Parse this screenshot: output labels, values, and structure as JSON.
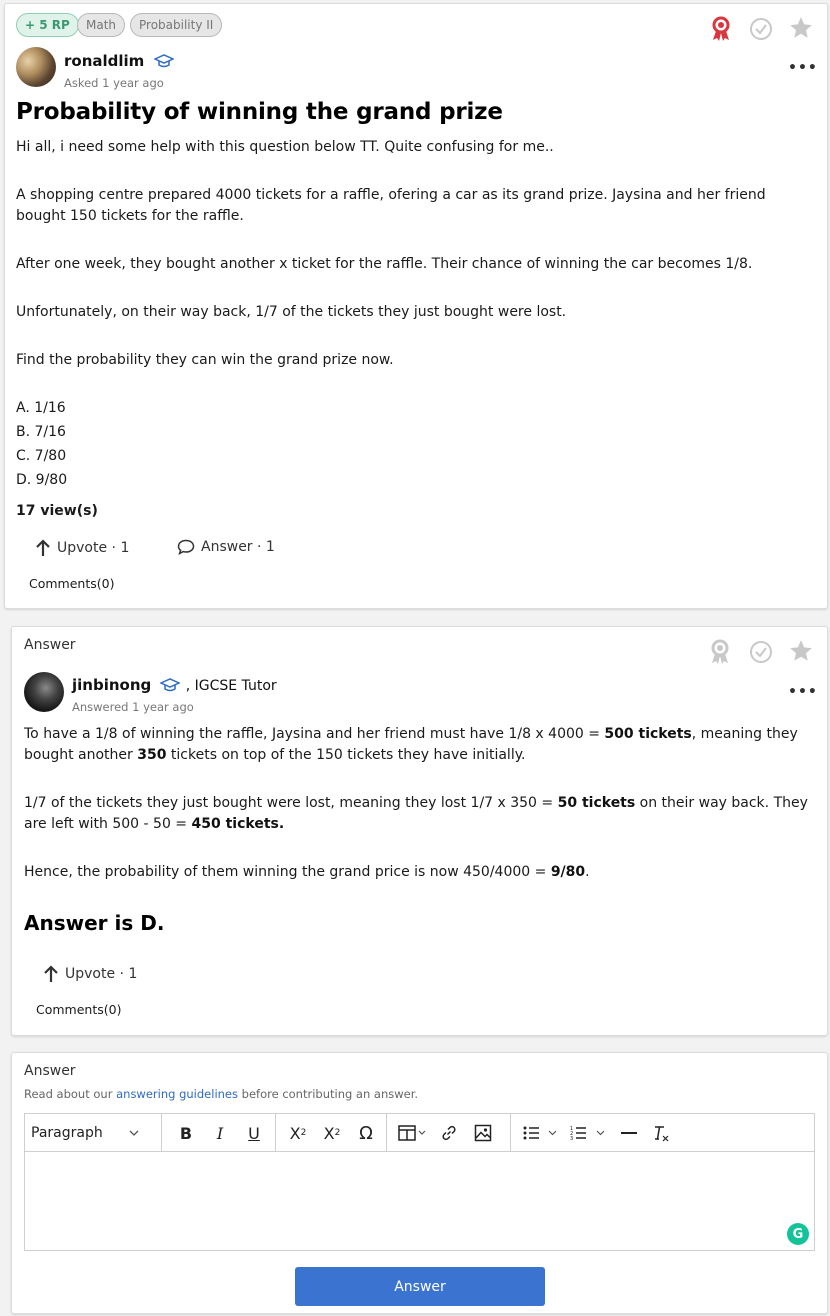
{
  "question": {
    "tags": {
      "rp": "+ 5 RP",
      "subject": "Math",
      "topic": "Probability II"
    },
    "author": {
      "name": "ronaldlim",
      "meta": "Asked 1 year ago"
    },
    "title": "Probability of winning the grand prize",
    "body": [
      "Hi all, i need some help with this question below TT. Quite confusing for me..",
      "A shopping centre prepared 4000 tickets for a raffle, ofering a car as its grand prize. Jaysina and her friend",
      "bought 150 tickets for the raffle.",
      "After one week, they bought another x ticket for the raffle. Their chance of winning the car becomes 1/8.",
      "Unfortunately, on their way back, 1/7 of the tickets they just bought were lost.",
      "Find the probability they can win the grand prize now."
    ],
    "options": [
      "A. 1/16",
      "B. 7/16",
      "C. 7/80",
      "D. 9/80"
    ],
    "views": "17 view(s)",
    "upvote": "Upvote · 1",
    "answer": "Answer · 1",
    "comments": "Comments(0)"
  },
  "answer": {
    "heading": "Answer",
    "author": {
      "name": "jinbinong",
      "role": ", IGCSE Tutor",
      "meta": "Answered 1 year ago"
    },
    "p1": {
      "a": "To have a 1/8 of winning the raffle, Jaysina and her friend must have 1/8 x 4000 = ",
      "b": "500 tickets",
      "c": ", meaning they",
      "d": "bought another ",
      "e": "350",
      "f": " tickets on top of the 150 tickets they have initially."
    },
    "p2": {
      "a": "1/7 of the tickets they just bought were lost, meaning they lost 1/7 x 350 = ",
      "b": "50 tickets",
      "c": " on their way back. They",
      "d": "are left with 500 - 50 = ",
      "e": "450 tickets."
    },
    "p3": {
      "a": "Hence, the probability of them winning the grand price is now 450/4000 = ",
      "b": "9/80",
      "c": "."
    },
    "conclusion": "Answer is D.",
    "upvote": "Upvote · 1",
    "comments": "Comments(0)"
  },
  "editor": {
    "heading": "Answer",
    "guide_before": "Read about our ",
    "guide_link": "answering guidelines",
    "guide_after": " before contributing an answer.",
    "paragraph": "Paragraph",
    "submit": "Answer"
  },
  "colors": {
    "accent": "#3b74d0",
    "badge_red": "#d9363e",
    "rp_green": "#3d9970",
    "grammarly": "#15c39a"
  }
}
